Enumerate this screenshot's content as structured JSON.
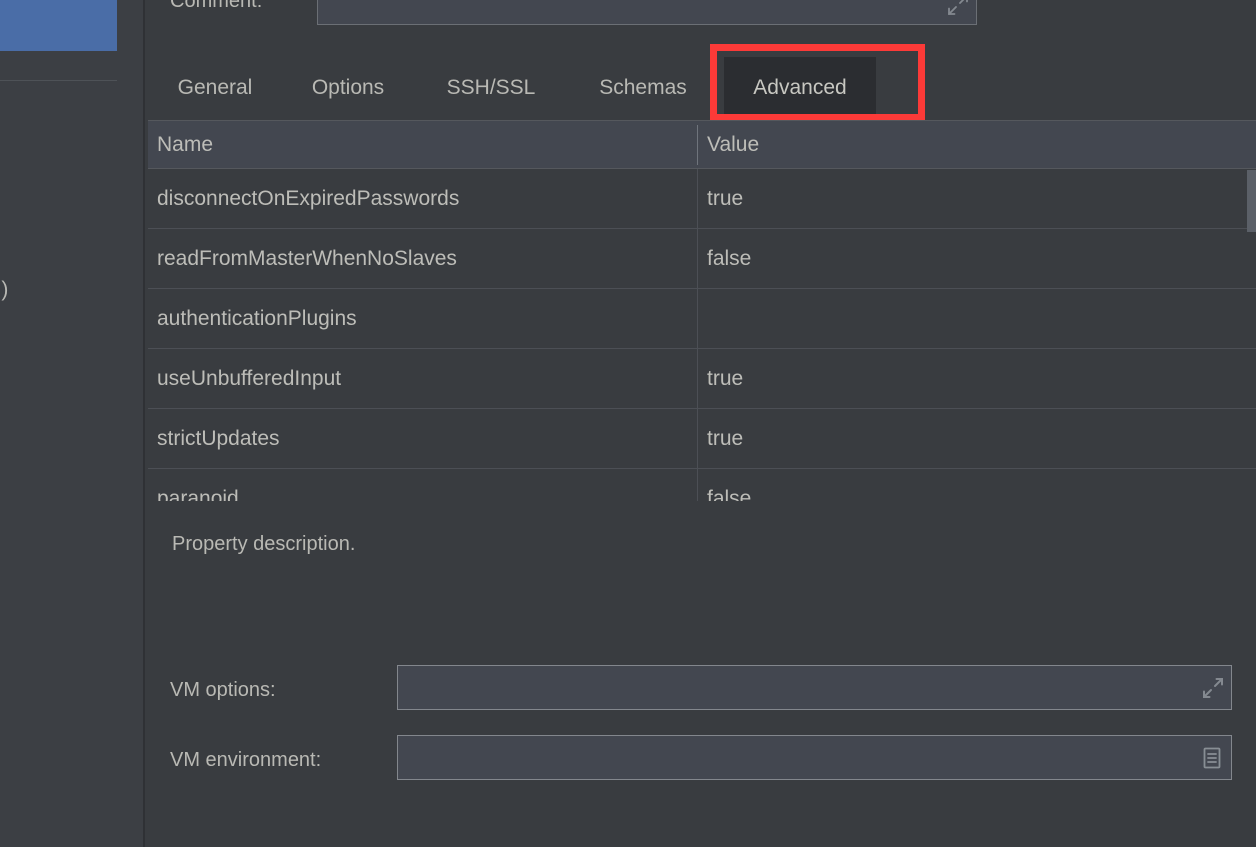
{
  "left_panel": {
    "selected_item_label": "",
    "clipped_fragments": [
      "ded)",
      "e)"
    ],
    "scrollbar": "vertical-scrollbar"
  },
  "comment": {
    "label": "Comment:",
    "value": "",
    "placeholder": "",
    "expand_icon": "expand-icon"
  },
  "tabs": [
    {
      "label": "General",
      "selected": false
    },
    {
      "label": "Options",
      "selected": false
    },
    {
      "label": "SSH/SSL",
      "selected": false
    },
    {
      "label": "Schemas",
      "selected": false
    },
    {
      "label": "Advanced",
      "selected": true
    }
  ],
  "highlight": {
    "target": "Advanced",
    "color": "#fc3a38"
  },
  "table": {
    "columns": [
      "Name",
      "Value"
    ],
    "rows": [
      {
        "name": "disconnectOnExpiredPasswords",
        "value": "true"
      },
      {
        "name": "readFromMasterWhenNoSlaves",
        "value": "false"
      },
      {
        "name": "authenticationPlugins",
        "value": ""
      },
      {
        "name": "useUnbufferedInput",
        "value": "true"
      },
      {
        "name": "strictUpdates",
        "value": "true"
      },
      {
        "name": "paranoid",
        "value": "false"
      }
    ]
  },
  "description": {
    "text": "Property description."
  },
  "fields": [
    {
      "label": "VM options:",
      "value": "",
      "icon": "expand-icon"
    },
    {
      "label": "VM environment:",
      "value": "",
      "icon": "document-icon"
    }
  ],
  "colors": {
    "panel_background": "#393c40",
    "sidebar_background": "#3c3f44",
    "selection_blue": "#4a6da7",
    "tab_underline": "#4a7ebb",
    "highlight_red": "#fc3a38",
    "text": "#b9b9b4",
    "header_row": "#434750"
  }
}
